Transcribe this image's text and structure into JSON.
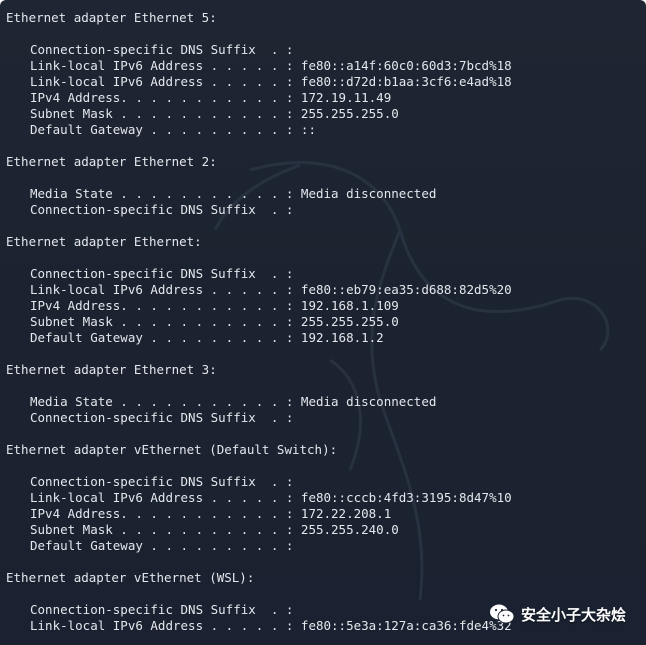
{
  "theme": {
    "bg": "#1c2330",
    "text": "#e4e7ec"
  },
  "sections": [
    {
      "header": "Ethernet adapter Ethernet 5:",
      "rows": [
        "Connection-specific DNS Suffix  . :",
        "Link-local IPv6 Address . . . . . : fe80::a14f:60c0:60d3:7bcd%18",
        "Link-local IPv6 Address . . . . . : fe80::d72d:b1aa:3cf6:e4ad%18",
        "IPv4 Address. . . . . . . . . . . : 172.19.11.49",
        "Subnet Mask . . . . . . . . . . . : 255.255.255.0",
        "Default Gateway . . . . . . . . . : ::"
      ]
    },
    {
      "header": "Ethernet adapter Ethernet 2:",
      "rows": [
        "Media State . . . . . . . . . . . : Media disconnected",
        "Connection-specific DNS Suffix  . :"
      ]
    },
    {
      "header": "Ethernet adapter Ethernet:",
      "rows": [
        "Connection-specific DNS Suffix  . :",
        "Link-local IPv6 Address . . . . . : fe80::eb79:ea35:d688:82d5%20",
        "IPv4 Address. . . . . . . . . . . : 192.168.1.109",
        "Subnet Mask . . . . . . . . . . . : 255.255.255.0",
        "Default Gateway . . . . . . . . . : 192.168.1.2"
      ]
    },
    {
      "header": "Ethernet adapter Ethernet 3:",
      "rows": [
        "Media State . . . . . . . . . . . : Media disconnected",
        "Connection-specific DNS Suffix  . :"
      ]
    },
    {
      "header": "Ethernet adapter vEthernet (Default Switch):",
      "rows": [
        "Connection-specific DNS Suffix  . :",
        "Link-local IPv6 Address . . . . . : fe80::cccb:4fd3:3195:8d47%10",
        "IPv4 Address. . . . . . . . . . . : 172.22.208.1",
        "Subnet Mask . . . . . . . . . . . : 255.255.240.0",
        "Default Gateway . . . . . . . . . :"
      ]
    },
    {
      "header": "Ethernet adapter vEthernet (WSL):",
      "rows": [
        "Connection-specific DNS Suffix  . :",
        "Link-local IPv6 Address . . . . . : fe80::5e3a:127a:ca36:fde4%32"
      ]
    }
  ],
  "watermark": {
    "icon": "wechat-icon",
    "text": "安全小子大杂烩"
  }
}
